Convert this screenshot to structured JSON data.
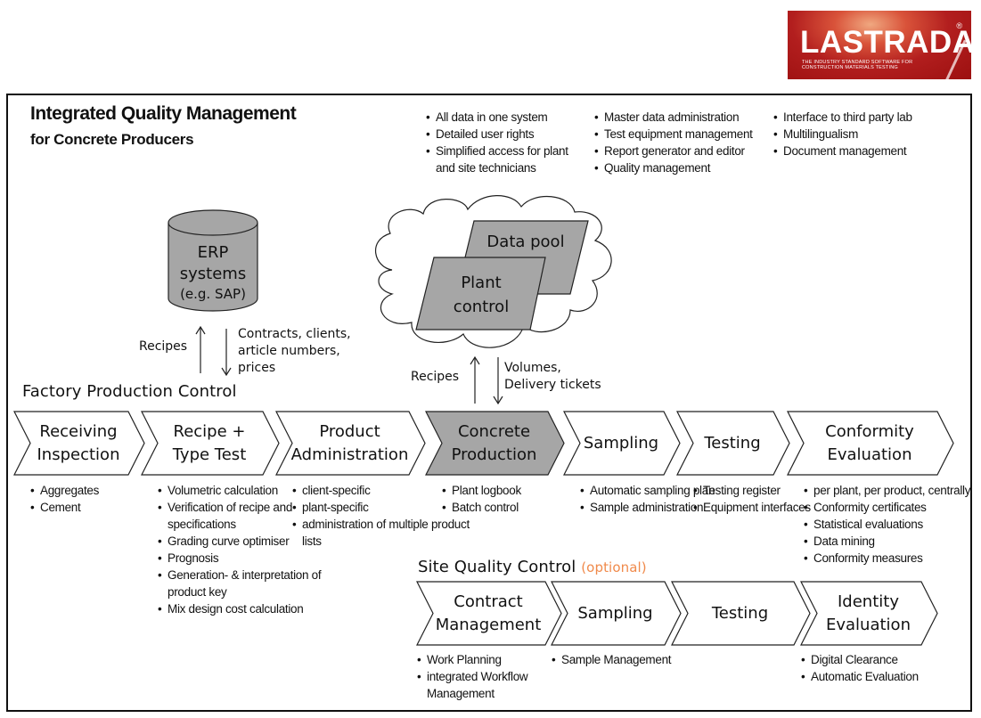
{
  "logo": {
    "brand": "LASTRADA",
    "registered": "®",
    "tagline_1": "The industry standard software for",
    "tagline_2": "construction materials testing",
    "colors": {
      "background": "#a8161a",
      "text": "#ffffff"
    }
  },
  "header": {
    "title": "Integrated Quality Management",
    "subtitle": "for Concrete Producers"
  },
  "features": {
    "col1": [
      "All data in one system",
      "Detailed user rights",
      "Simplified access for plant and site technicians"
    ],
    "col2": [
      "Master data administration",
      "Test equipment management",
      "Report generator and editor",
      "Quality management"
    ],
    "col3": [
      "Interface to third party lab",
      "Multilingualism",
      "Document management"
    ]
  },
  "erp": {
    "line1": "ERP",
    "line2": "systems",
    "line3": "(e.g. SAP)",
    "up_label": "Recipes",
    "down_label_1": "Contracts, clients,",
    "down_label_2": "article numbers,",
    "down_label_3": "prices",
    "fill": "#a6a6a6"
  },
  "cloud": {
    "data_pool": "Data pool",
    "plant_control_1": "Plant",
    "plant_control_2": "control",
    "up_label": "Recipes",
    "down_label_1": "Volumes,",
    "down_label_2": "Delivery tickets"
  },
  "factory": {
    "section_title": "Factory Production Control",
    "steps": [
      {
        "line1": "Receiving",
        "line2": "Inspection",
        "highlighted": false,
        "bullets": [
          "Aggregates",
          "Cement"
        ]
      },
      {
        "line1": "Recipe +",
        "line2": "Type Test",
        "highlighted": false,
        "bullets": [
          "Volumetric calculation",
          "Verification of recipe and specifications",
          "Grading curve optimiser",
          "Prognosis",
          "Generation- & interpretation of product key",
          "Mix design cost calculation"
        ]
      },
      {
        "line1": "Product",
        "line2": "Administration",
        "highlighted": false,
        "bullets": [
          "client-specific",
          "plant-specific",
          "administration of multiple product lists"
        ]
      },
      {
        "line1": "Concrete",
        "line2": "Production",
        "highlighted": true,
        "bullets": [
          "Plant logbook",
          "Batch control"
        ]
      },
      {
        "line1": "Sampling",
        "line2": "",
        "highlighted": false,
        "bullets": [
          "Automatic sampling plan",
          "Sample administration"
        ]
      },
      {
        "line1": "Testing",
        "line2": "",
        "highlighted": false,
        "bullets": [
          "Testing register",
          "Equipment interfaces"
        ]
      },
      {
        "line1": "Conformity",
        "line2": "Evaluation",
        "highlighted": false,
        "bullets": [
          "per plant, per product, centrally",
          "Conformity certificates",
          "Statistical evaluations",
          "Data mining",
          "Conformity measures"
        ]
      }
    ]
  },
  "site": {
    "section_title": "Site Quality Control",
    "optional_label": "(optional)",
    "optional_color": "#f08a4b",
    "steps": [
      {
        "line1": "Contract",
        "line2": "Management",
        "bullets": [
          "Work Planning",
          "integrated Workflow Management"
        ]
      },
      {
        "line1": "Sampling",
        "line2": "",
        "bullets": [
          "Sample Management"
        ]
      },
      {
        "line1": "Testing",
        "line2": "",
        "bullets": []
      },
      {
        "line1": "Identity",
        "line2": "Evaluation",
        "bullets": [
          "Digital Clearance",
          "Automatic Evaluation"
        ]
      }
    ]
  },
  "colors": {
    "highlight_fill": "#a6a6a6",
    "stroke": "#222222"
  }
}
